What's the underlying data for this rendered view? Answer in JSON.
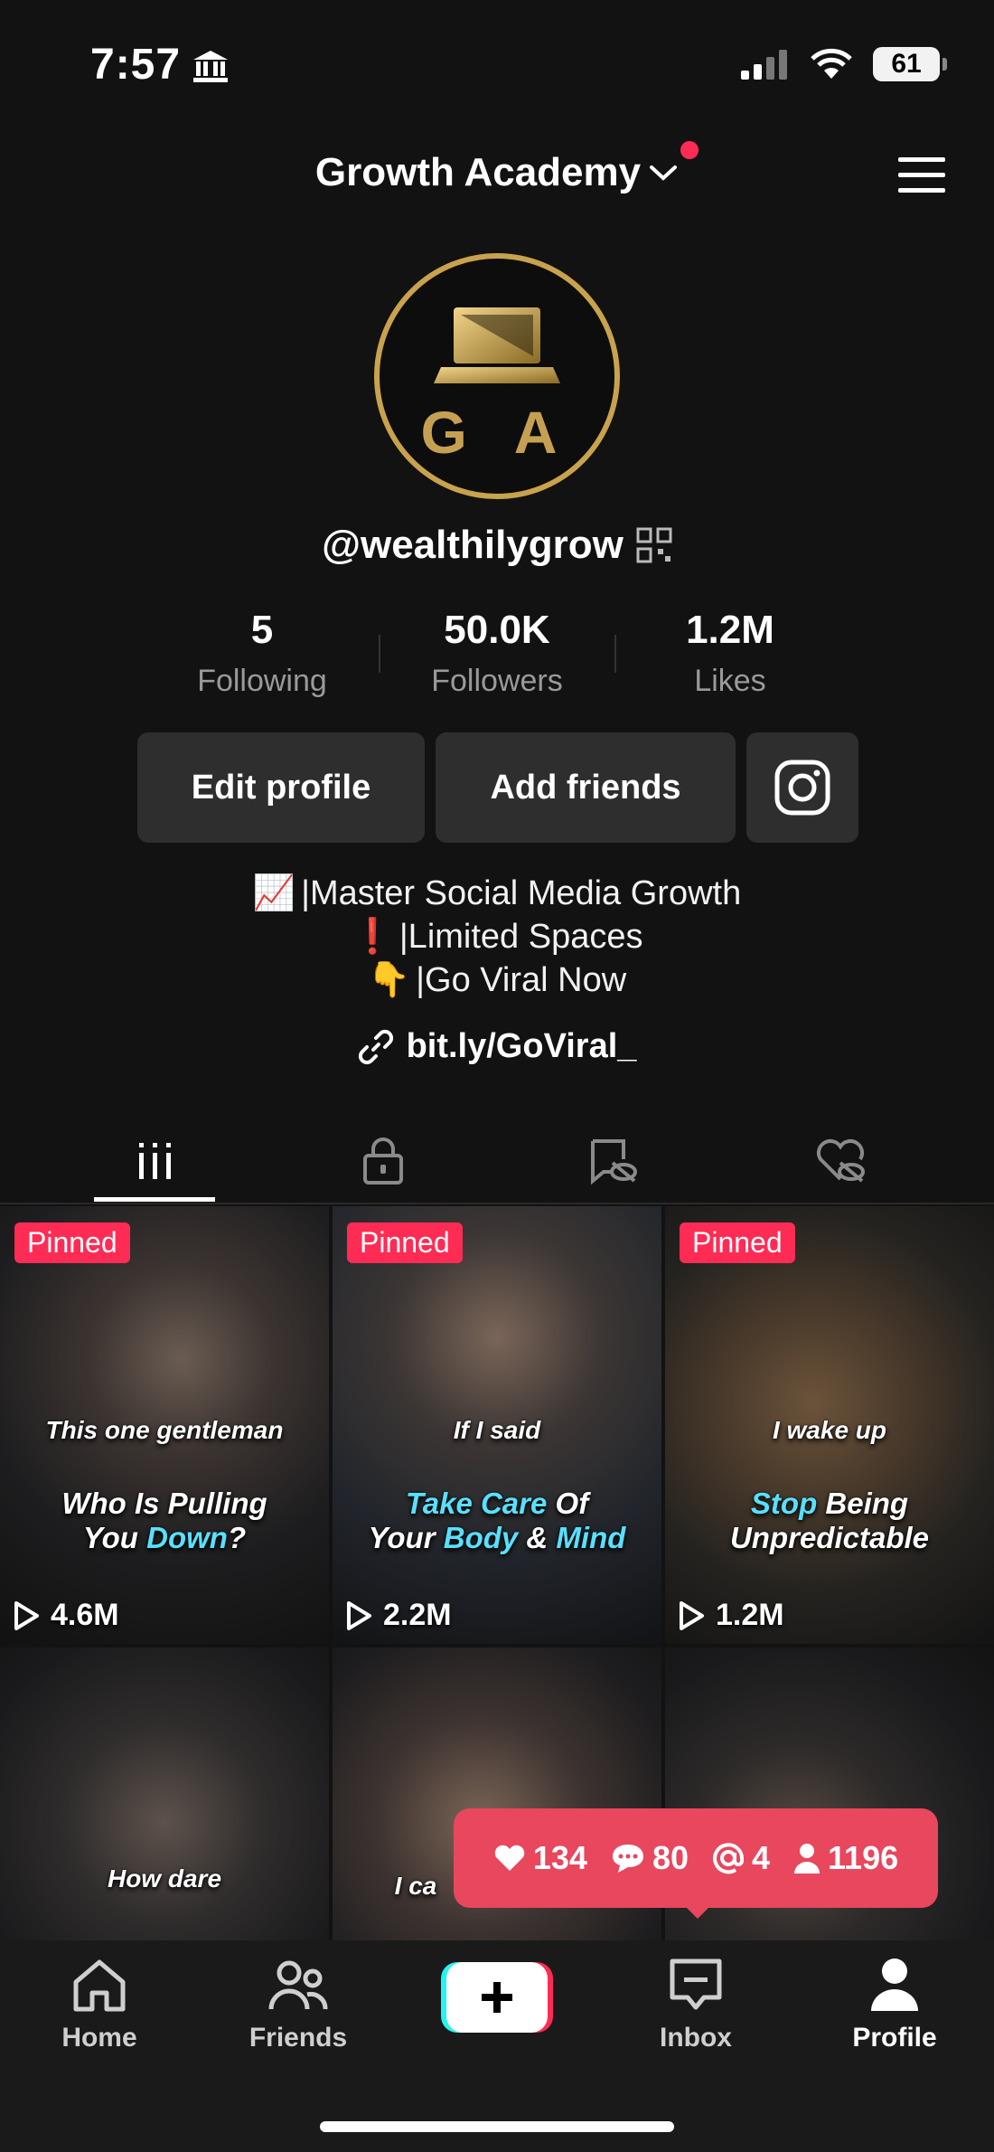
{
  "status": {
    "time": "7:57",
    "battery": "61"
  },
  "header": {
    "account_name": "Growth Academy"
  },
  "profile": {
    "avatar_letters": "G A",
    "handle": "@wealthilygrow",
    "stats": [
      {
        "value": "5",
        "label": "Following"
      },
      {
        "value": "50.0K",
        "label": "Followers"
      },
      {
        "value": "1.2M",
        "label": "Likes"
      }
    ],
    "buttons": {
      "edit": "Edit profile",
      "add_friends": "Add friends"
    },
    "bio": [
      {
        "emoji": "📈",
        "text": "|Master Social Media Growth"
      },
      {
        "emoji": "❗",
        "text": "|Limited Spaces"
      },
      {
        "emoji": "👇",
        "text": "|Go Viral Now"
      }
    ],
    "link": "bit.ly/GoViral_"
  },
  "videos": [
    {
      "pinned": "Pinned",
      "caption_top": "This one gentleman",
      "caption_a": "Who Is Pulling",
      "caption_b": "You ",
      "caption_b_hl": "Down",
      "caption_b_end": "?",
      "views": "4.6M"
    },
    {
      "pinned": "Pinned",
      "caption_top": "If I said",
      "caption_a_hl": "Take Care",
      "caption_a": " Of",
      "caption_b": "Your ",
      "caption_b_hl": "Body",
      "caption_b_mid": " & ",
      "caption_b_hl2": "Mind",
      "views": "2.2M"
    },
    {
      "pinned": "Pinned",
      "caption_top": "I wake up",
      "caption_a_hl": "Stop",
      "caption_a": " Being",
      "caption_b": "Unpredictable",
      "views": "1.2M"
    },
    {
      "caption_top": "How dare"
    },
    {
      "caption_top": "I ca"
    },
    {}
  ],
  "popup": {
    "likes": "134",
    "comments": "80",
    "mentions": "4",
    "followers": "1196"
  },
  "nav": {
    "home": "Home",
    "friends": "Friends",
    "inbox": "Inbox",
    "profile": "Profile"
  },
  "colors": {
    "accent": "#fe2c55",
    "gold": "#c9a24d",
    "popup": "#e8475e",
    "highlight": "#58e0ff"
  }
}
